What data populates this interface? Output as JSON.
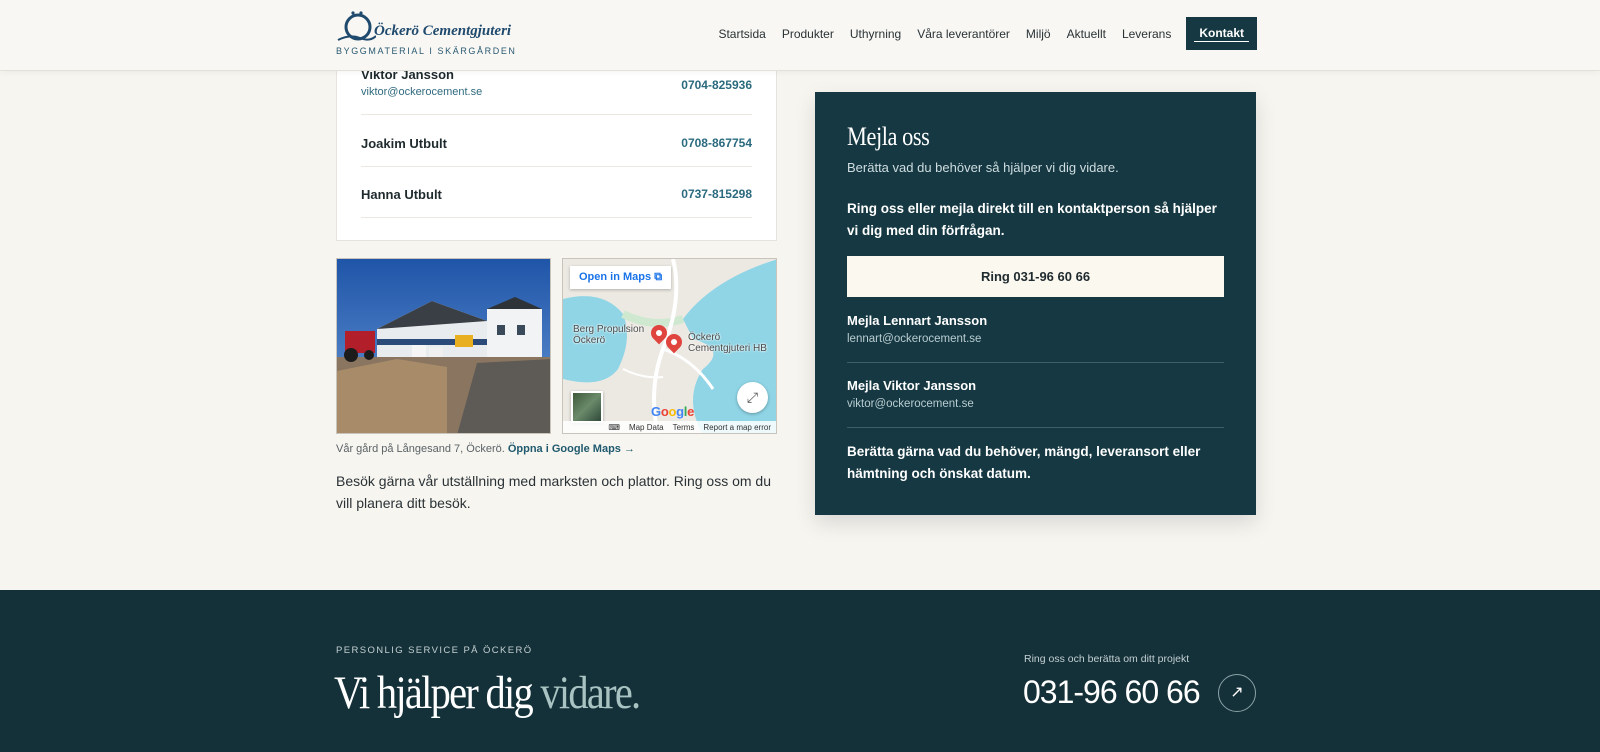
{
  "header": {
    "logo_name": "Öckerö Cementgjuteri",
    "logo_tagline": "BYGGMATERIAL I SKÄRGÅRDEN",
    "nav": [
      "Startsida",
      "Produkter",
      "Uthyrning",
      "Våra leverantörer",
      "Miljö",
      "Aktuellt",
      "Leverans"
    ],
    "cta": "Kontakt"
  },
  "contacts": [
    {
      "name": "Viktor Jansson",
      "email": "viktor@ockerocement.se",
      "phone": "0704-825936"
    },
    {
      "name": "Joakim Utbult",
      "email": "",
      "phone": "0708-867754"
    },
    {
      "name": "Hanna Utbult",
      "email": "",
      "phone": "0737-815298"
    }
  ],
  "map": {
    "open_label": "Open in Maps",
    "label_berg": "Berg Propulsion\nÖckerö",
    "label_ockero": "Öckerö\nCementgjuteri HB",
    "google": "Google",
    "footer": [
      "Map Data",
      "Terms",
      "Report a map error"
    ]
  },
  "caption": {
    "text": "Vår gård på Långesand 7, Öckerö.",
    "link": "Öppna i Google Maps →"
  },
  "visit_text": "Besök gärna vår utställning med marksten och plattor. Ring oss om du vill planera ditt besök.",
  "panel": {
    "title": "Mejla oss",
    "lead": "Berätta vad du behöver så hjälper vi dig vidare.",
    "body": "Ring oss eller mejla direkt till en kontaktperson så hjälper vi dig med din förfrågan.",
    "ring_button": "Ring 031-96 60 66",
    "mail_rows": [
      {
        "title": "Mejla Lennart Jansson",
        "email": "lennart@ockerocement.se"
      },
      {
        "title": "Mejla Viktor Jansson",
        "email": "viktor@ockerocement.se"
      }
    ],
    "note": "Berätta gärna vad du behöver, mängd, leveransort eller hämtning och önskat datum."
  },
  "footer": {
    "eyebrow": "PERSONLIG SERVICE PÅ ÖCKERÖ",
    "title_main": "Vi hjälper dig",
    "title_light": "vidare.",
    "small": "Ring oss och berätta om ditt projekt",
    "phone": "031-96 60 66",
    "arrow": "↗"
  },
  "colors": {
    "primary_dark": "#153842",
    "background": "#f7f5f0",
    "accent_link": "#2a6a7e"
  },
  "icons": [
    "accessibility-icon",
    "external-link-icon",
    "fullscreen-icon",
    "arrow-up-right-icon"
  ]
}
